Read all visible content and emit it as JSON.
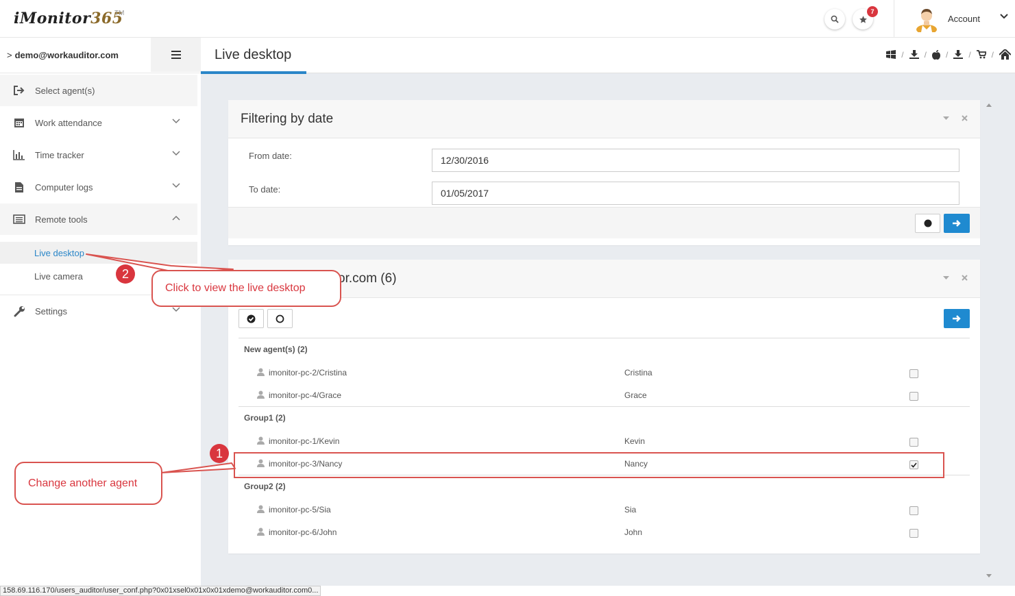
{
  "app": {
    "logo_main": "iMonitor",
    "logo_num": "365",
    "logo_tm": "TM",
    "notification_count": "7",
    "account_label": "Account"
  },
  "sidebar": {
    "user_email": "demo@workauditor.com",
    "items": [
      {
        "label": "Select agent(s)",
        "icon": "sign-out-icon"
      },
      {
        "label": "Work attendance",
        "icon": "calendar-icon"
      },
      {
        "label": "Time tracker",
        "icon": "bar-chart-icon"
      },
      {
        "label": "Computer logs",
        "icon": "file-icon"
      },
      {
        "label": "Remote tools",
        "icon": "list-alt-icon"
      },
      {
        "label": "Settings",
        "icon": "wrench-icon"
      }
    ],
    "submenu": [
      {
        "label": "Live desktop",
        "active": true
      },
      {
        "label": "Live camera",
        "active": false
      }
    ]
  },
  "page": {
    "title": "Live desktop"
  },
  "filter_panel": {
    "title": "Filtering by date",
    "from_label": "From date:",
    "from_value": "12/30/2016",
    "to_label": "To date:",
    "to_value": "01/05/2017"
  },
  "agents_panel": {
    "title_visible": "or.com (6)",
    "groups": [
      {
        "name": "New agent(s) (2)",
        "agents": [
          {
            "computer": "imonitor-pc-2/Cristina",
            "user": "Cristina",
            "checked": false
          },
          {
            "computer": "imonitor-pc-4/Grace",
            "user": "Grace",
            "checked": false
          }
        ]
      },
      {
        "name": "Group1 (2)",
        "agents": [
          {
            "computer": "imonitor-pc-1/Kevin",
            "user": "Kevin",
            "checked": false
          },
          {
            "computer": "imonitor-pc-3/Nancy",
            "user": "Nancy",
            "checked": true
          }
        ]
      },
      {
        "name": "Group2 (2)",
        "agents": [
          {
            "computer": "imonitor-pc-5/Sia",
            "user": "Sia",
            "checked": false
          },
          {
            "computer": "imonitor-pc-6/John",
            "user": "John",
            "checked": false
          }
        ]
      }
    ]
  },
  "annotations": {
    "callout_1_text": "Change another agent",
    "callout_1_num": "1",
    "callout_2_text": "Click to view the live desktop",
    "callout_2_num": "2"
  },
  "statusbar": {
    "url": "158.69.116.170/users_auditor/user_conf.php?0x01xsel0x01x0x01xdemo@workauditor.com0..."
  },
  "colors": {
    "accent": "#1f8ad0",
    "annotation": "#d9363e",
    "badge": "#d9363e"
  }
}
